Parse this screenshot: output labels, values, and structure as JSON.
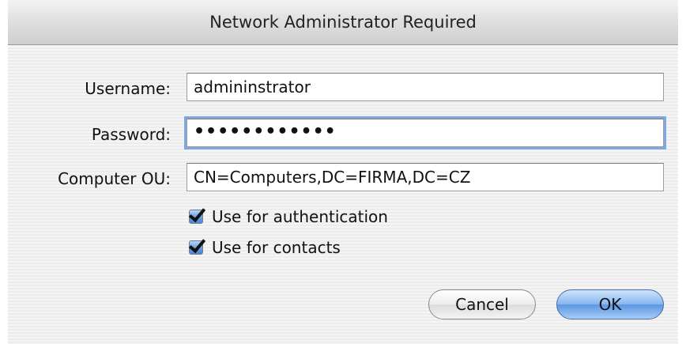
{
  "window": {
    "title": "Network Administrator Required"
  },
  "form": {
    "username_label": "Username:",
    "username_value": "admininstrator",
    "password_label": "Password:",
    "password_value": "••••••••••••",
    "ou_label": "Computer OU:",
    "ou_value": "CN=Computers,DC=FIRMA,DC=CZ"
  },
  "options": {
    "auth_label": "Use for authentication",
    "auth_checked": true,
    "contacts_label": "Use for contacts",
    "contacts_checked": true
  },
  "buttons": {
    "cancel": "Cancel",
    "ok": "OK"
  },
  "colors": {
    "focus_ring": "#7da8e4",
    "checkbox_accent": "#5c98e3",
    "default_button": "#8ab8ef"
  }
}
